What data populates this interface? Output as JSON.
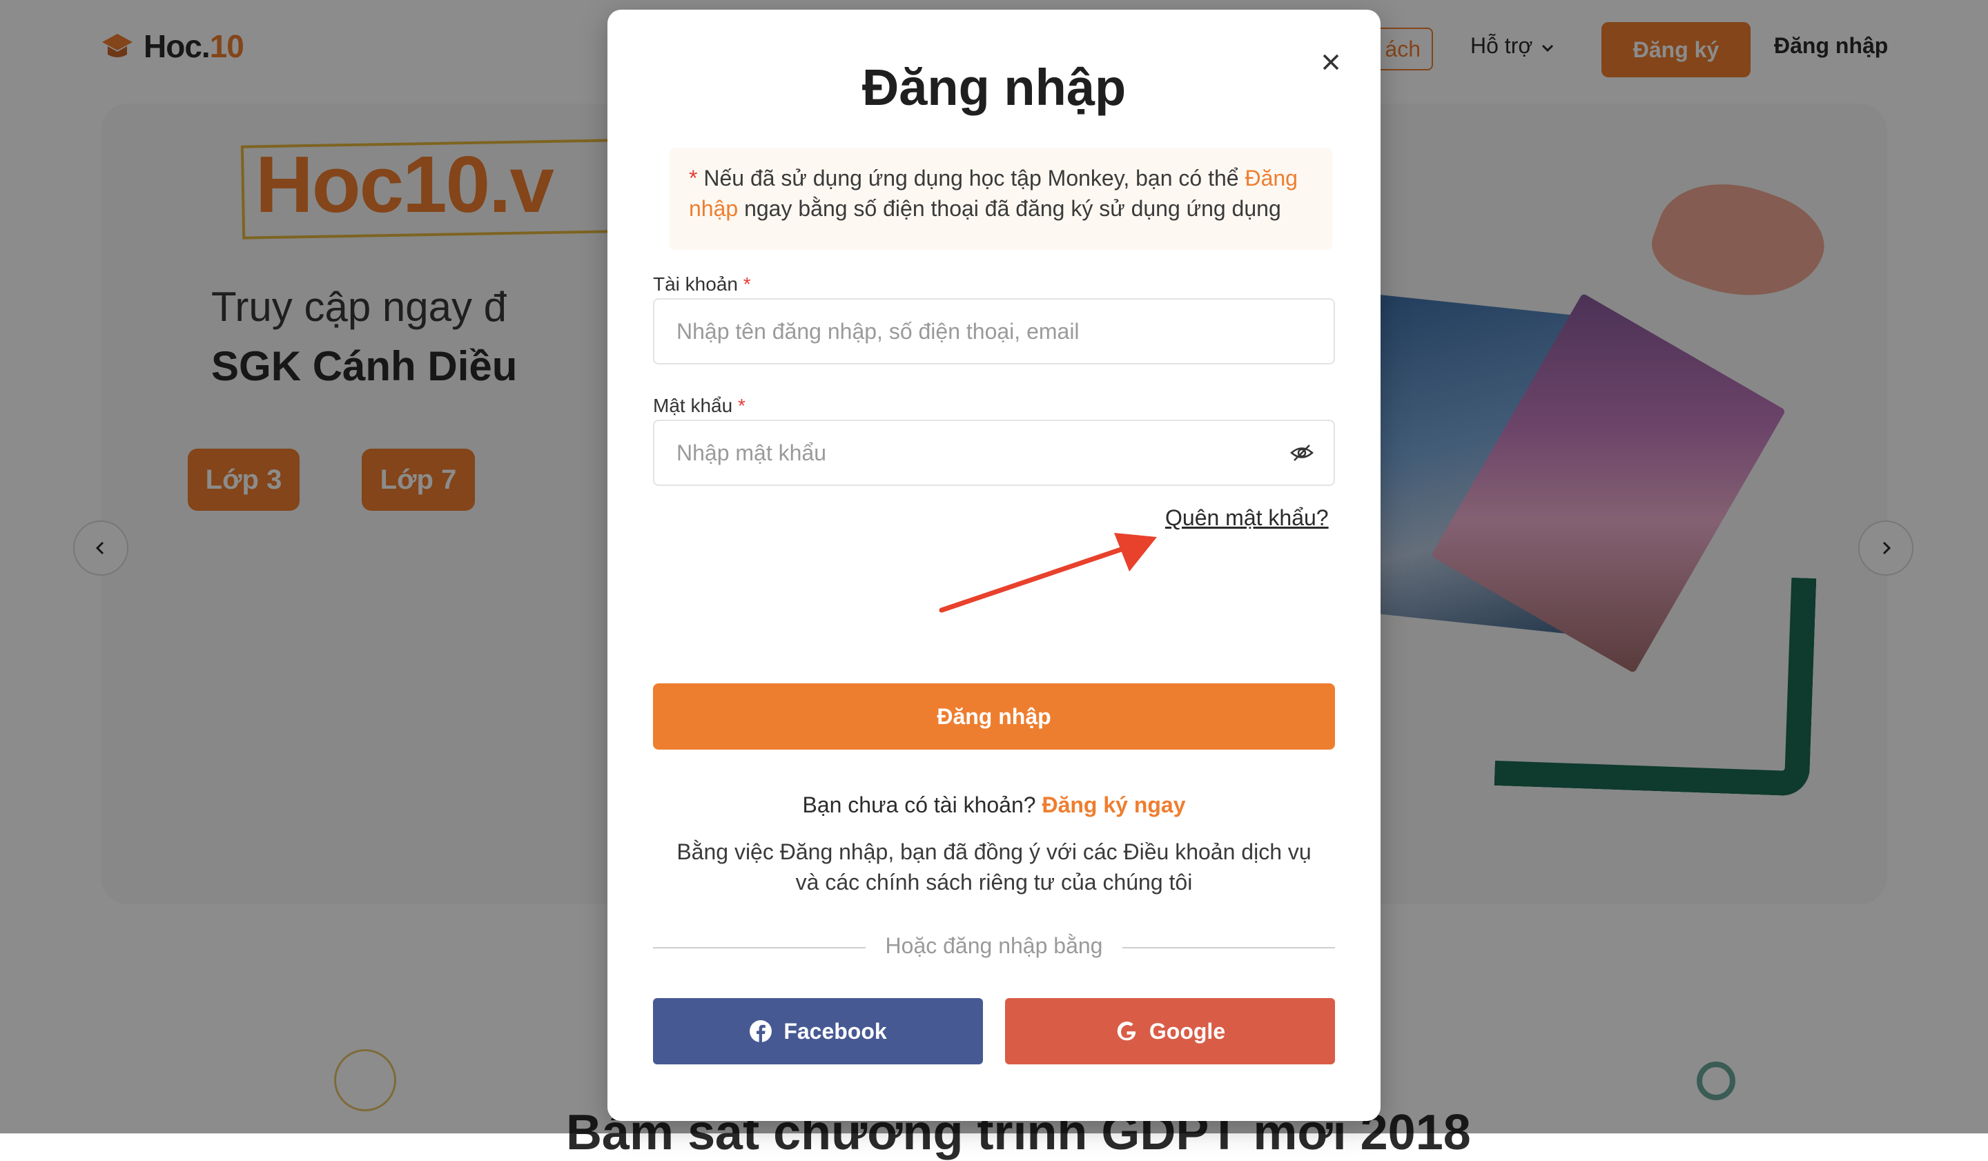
{
  "background": {
    "logo": {
      "text_main": "Hoc.",
      "text_accent": "10"
    },
    "nav": {
      "partial_item": "ách",
      "support": "Hỗ trợ",
      "register": "Đăng ký",
      "login": "Đăng nhập"
    },
    "hero": {
      "title": "Hoc10.v",
      "subtitle_1": "Truy cập ngay đ",
      "subtitle_2": "SGK Cánh Diều",
      "grades": [
        "Lớp 3",
        "Lớp 7"
      ]
    },
    "bottom_heading": "Bám sát chương trình GDPT mới 2018"
  },
  "modal": {
    "title": "Đăng nhập",
    "notice": {
      "marker": "*",
      "text_before": " Nếu đã sử dụng ứng dụng học tập Monkey, bạn có thể ",
      "link": "Đăng nhập",
      "text_after": " ngay bằng số điện thoại đã đăng ký sử dụng ứng dụng"
    },
    "account": {
      "label": "Tài khoản",
      "required": "*",
      "placeholder": "Nhập tên đăng nhập, số điện thoại, email",
      "value": ""
    },
    "password": {
      "label": "Mật khẩu",
      "required": "*",
      "placeholder": "Nhập mật khẩu",
      "value": ""
    },
    "forgot_password": "Quên mật khẩu?",
    "submit": "Đăng nhập",
    "no_account": {
      "text": "Bạn chưa có tài khoản? ",
      "link": "Đăng ký ngay"
    },
    "terms_line1": "Bằng việc Đăng nhập, bạn đã đồng ý với các Điều khoản dịch vụ",
    "terms_line2": "và các chính sách riêng tư của chúng tôi",
    "divider": "Hoặc đăng nhập bằng",
    "social": {
      "facebook": "Facebook",
      "google": "Google"
    }
  },
  "colors": {
    "accent": "#ee7e2f",
    "facebook": "#475993",
    "google": "#d95c47",
    "annotation_arrow": "#e8412c"
  },
  "icons": {
    "close": "close-icon",
    "eye": "eye-hidden-icon",
    "facebook": "facebook-icon",
    "google": "google-icon",
    "support_dropdown": "chevron-down-icon"
  }
}
